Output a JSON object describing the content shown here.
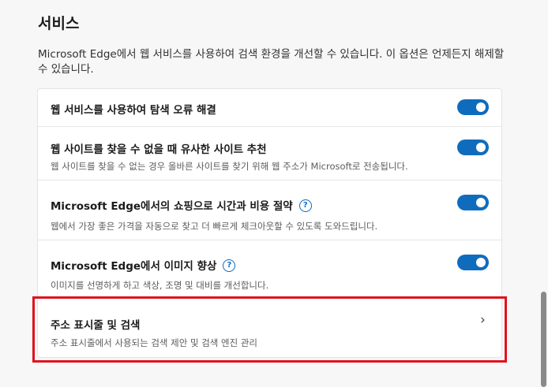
{
  "section": {
    "heading": "서비스",
    "intro": "Microsoft Edge에서 웹 서비스를 사용하여 검색 환경을 개선할 수 있습니다. 이 옵션은 언제든지 해제할 수 있습니다."
  },
  "settings": [
    {
      "title": "웹 서비스를 사용하여 탐색 오류 해결",
      "desc": "",
      "toggle": true
    },
    {
      "title": "웹 사이트를 찾을 수 없을 때 유사한 사이트 추천",
      "desc": "웹 사이트를 찾을 수 없는 경우 올바른 사이트를 찾기 위해 웹 주소가 Microsoft로 전송됩니다.",
      "toggle": true
    },
    {
      "title": "Microsoft Edge에서의 쇼핑으로 시간과 비용 절약",
      "desc": "웹에서 가장 좋은 가격을 자동으로 찾고 더 빠르게 체크아웃할 수 있도록 도와드립니다.",
      "toggle": true,
      "help": "?"
    },
    {
      "title": "Microsoft Edge에서 이미지 향상",
      "desc": "이미지를 선명하게 하고 색상, 조명 및 대비를 개선합니다.",
      "toggle": true,
      "help": "?"
    },
    {
      "title": "주소 표시줄 및 검색",
      "desc": "주소 표시줄에서 사용되는 검색 제안 및 검색 엔진 관리",
      "chevron": "›"
    }
  ],
  "colors": {
    "toggle_on": "#0f6cbd",
    "highlight": "#e0121d",
    "help_icon": "#0b6ac6"
  },
  "icons": {
    "help": "question-circle-icon",
    "chevron": "chevron-right-icon"
  }
}
